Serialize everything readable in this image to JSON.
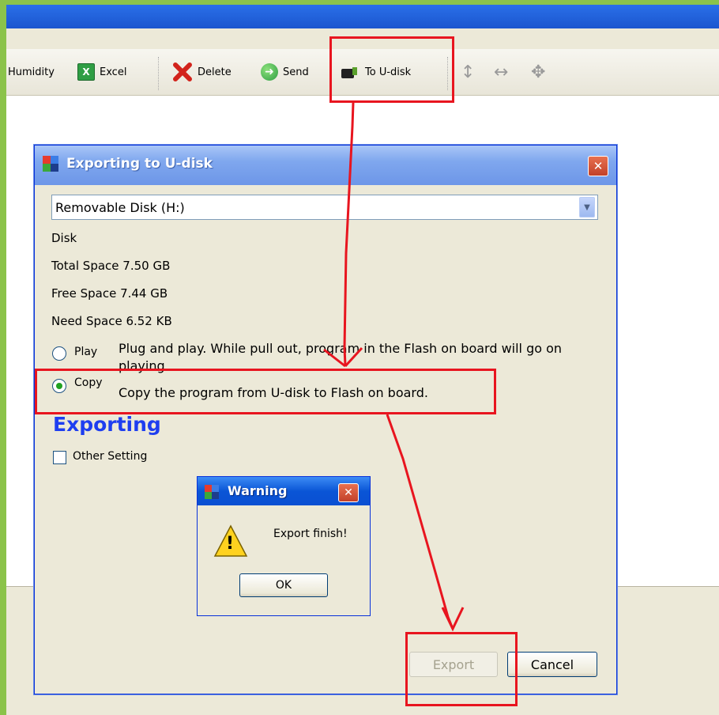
{
  "toolbar": {
    "humidity_label": "Humidity",
    "excel_label": "Excel",
    "excel_icon_glyph": "X",
    "delete_label": "Delete",
    "send_label": "Send",
    "to_udisk_label": "To U-disk"
  },
  "dialog": {
    "title": "Exporting to U-disk",
    "close_glyph": "✕",
    "drive_value": "Removable Disk (H:)",
    "disk_heading": "Disk",
    "total_space": "Total Space  7.50 GB",
    "free_space": "Free Space  7.44 GB",
    "need_space": "Need Space  6.52 KB",
    "options": [
      {
        "label": "Play",
        "desc": "Plug and play. While pull out, program in the Flash on board will go on playing.",
        "checked": false
      },
      {
        "label": "Copy",
        "desc": "Copy the program from U-disk to Flash on board.",
        "checked": true
      }
    ],
    "status": "Exporting",
    "other_setting_label": "Other Setting",
    "export_button": "Export",
    "cancel_button": "Cancel"
  },
  "warning": {
    "title": "Warning",
    "close_glyph": "✕",
    "message": "Export finish!",
    "ok_button": "OK",
    "icon_glyph": "!"
  },
  "colors": {
    "annotation_red": "#e8151f",
    "status_blue": "#1e3ef0",
    "background_green": "#8bc34a"
  }
}
